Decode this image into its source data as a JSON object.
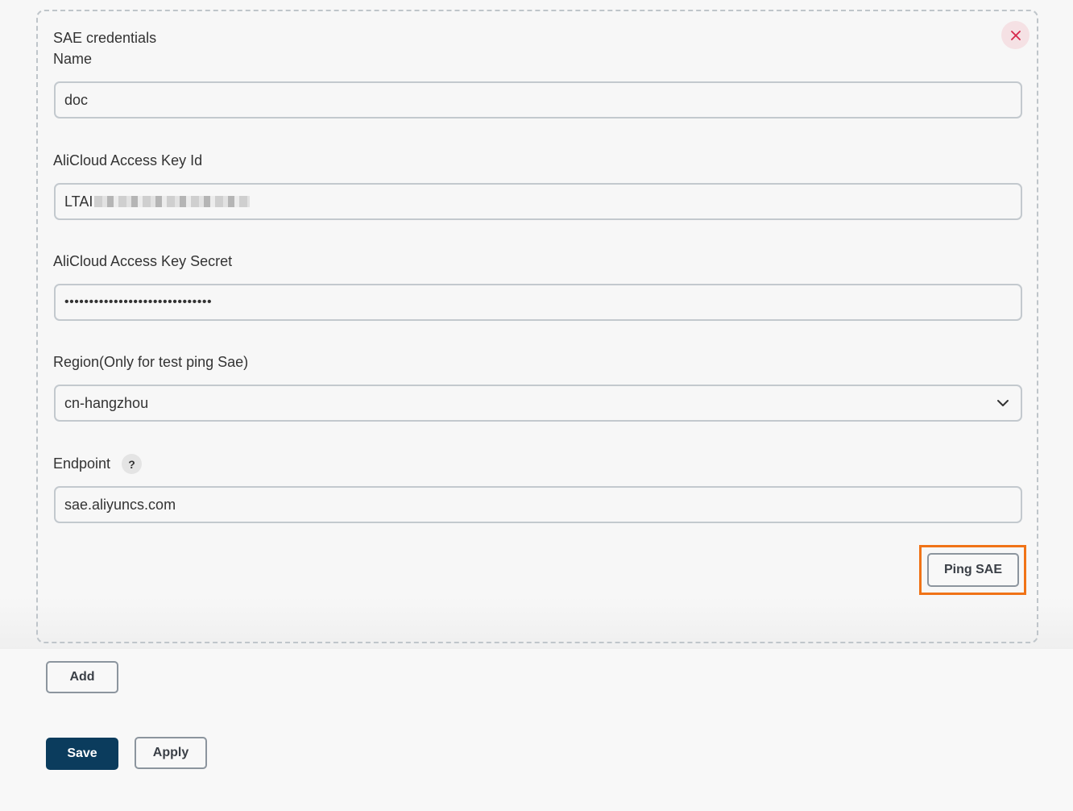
{
  "card": {
    "title": "SAE credentials",
    "close_icon": "close-icon"
  },
  "fields": {
    "name": {
      "label": "Name",
      "value": "doc"
    },
    "access_key_id": {
      "label": "AliCloud Access Key Id",
      "value_visible_prefix": "LTAI",
      "value_obscured": true
    },
    "access_key_secret": {
      "label": "AliCloud Access Key Secret",
      "value": "••••••••••••••••••••••••••••••"
    },
    "region": {
      "label": "Region(Only for test ping Sae)",
      "selected": "cn-hangzhou",
      "icon": "chevron-down-icon"
    },
    "endpoint": {
      "label": "Endpoint",
      "help_label": "?",
      "value": "sae.aliyuncs.com"
    }
  },
  "buttons": {
    "ping": "Ping SAE",
    "add": "Add",
    "save": "Save",
    "apply": "Apply"
  },
  "colors": {
    "primary": "#0b3c5d",
    "highlight": "#f07317",
    "danger": "#d6284b"
  }
}
